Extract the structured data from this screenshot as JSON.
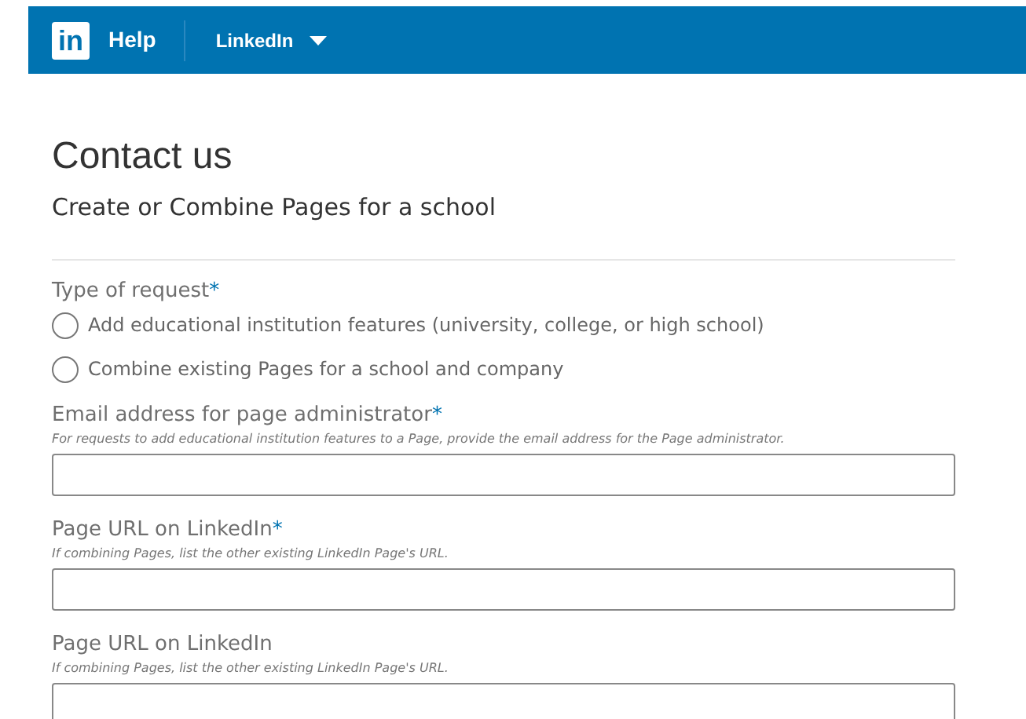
{
  "header": {
    "logo": "in",
    "title": "Help",
    "menu": "LinkedIn"
  },
  "page": {
    "title": "Contact us",
    "subtitle": "Create or Combine Pages for a school"
  },
  "request_type": {
    "label": "Type of request",
    "required_mark": "*",
    "options": [
      {
        "label": "Add educational institution features (university, college, or high school)",
        "selected": false
      },
      {
        "label": "Combine existing Pages for a school and company",
        "selected": false
      }
    ]
  },
  "fields": [
    {
      "label": "Email address for page administrator",
      "required_mark": "*",
      "hint": "For requests to add educational institution features to a Page, provide the email address for the Page administrator."
    },
    {
      "label": "Page URL on LinkedIn",
      "required_mark": "*",
      "hint": "If combining Pages, list the other existing LinkedIn Page's URL."
    },
    {
      "label": "Page URL on LinkedIn",
      "hint": "If combining Pages, list the other existing LinkedIn Page's URL."
    }
  ]
}
